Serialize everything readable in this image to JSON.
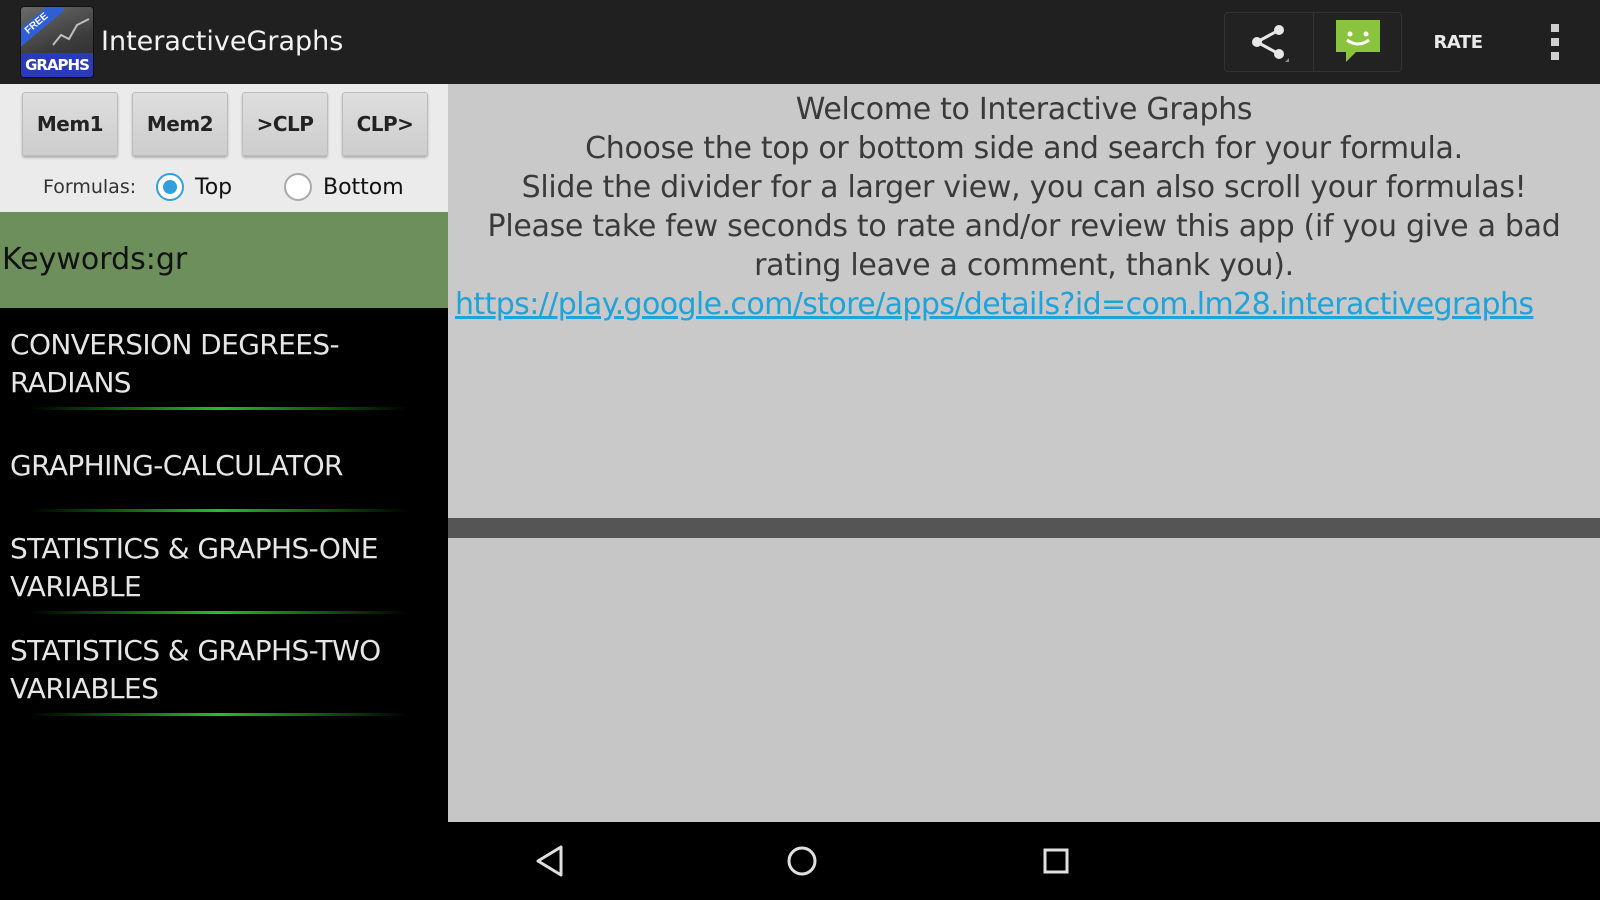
{
  "app": {
    "title": "InteractiveGraphs",
    "icon_banner": "FREE",
    "icon_caption": "GRAPHS"
  },
  "action_bar": {
    "share_icon": "share-icon",
    "feedback_icon": "chat-feedback-icon",
    "rate_label": "RATE",
    "overflow_icon": "overflow-menu-icon"
  },
  "controls": {
    "buttons": [
      "Mem1",
      "Mem2",
      ">CLP",
      "CLP>"
    ],
    "formulas_label": "Formulas:",
    "radio_top": "Top",
    "radio_bottom": "Bottom",
    "selected": "Top"
  },
  "keywords": "Keywords:gr",
  "list": [
    {
      "line1": "CONVERSION DEGREES-",
      "line2": "RADIANS"
    },
    {
      "line1": "GRAPHING-CALCULATOR",
      "line2": ""
    },
    {
      "line1": "STATISTICS & GRAPHS-ONE",
      "line2": "VARIABLE"
    },
    {
      "line1": "STATISTICS & GRAPHS-TWO",
      "line2": "VARIABLES"
    }
  ],
  "welcome": {
    "line1": "Welcome to Interactive Graphs",
    "line2": "Choose the top or bottom side and search for your formula.",
    "line3": "Slide the divider for a larger view, you can also scroll your formulas!",
    "line4": "Please take few seconds to rate and/or review this app (if you give a bad",
    "line5": "rating leave a comment, thank you).",
    "link": "https://play.google.com/store/apps/details?id=com.lm28.interactivegraphs"
  },
  "colors": {
    "action_bar": "#202020",
    "keywords_bar": "#6c8f5c",
    "link": "#1fa3d9",
    "radio_accent": "#33a0dd",
    "list_separator": "#22c222",
    "feedback_icon": "#8ac43f"
  },
  "nav": {
    "back_icon": "back-triangle-icon",
    "home_icon": "home-circle-icon",
    "recents_icon": "recents-square-icon"
  }
}
